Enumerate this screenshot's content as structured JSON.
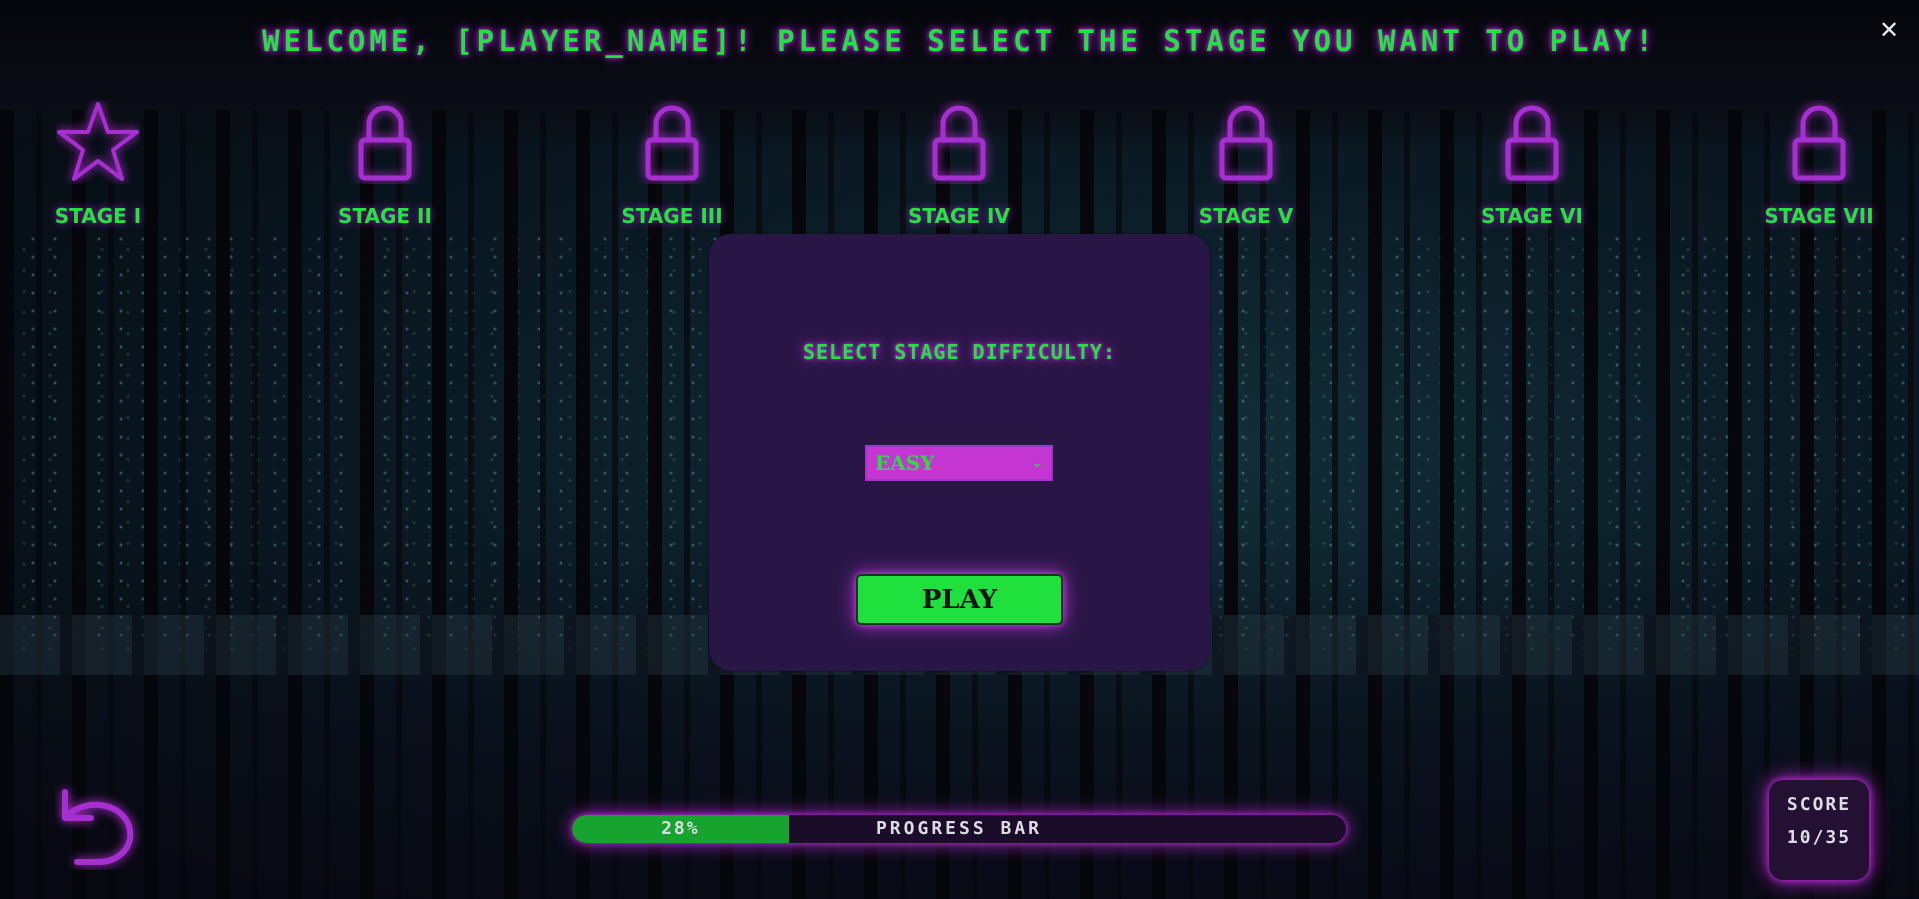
{
  "header": {
    "title": "WELCOME, [PLAYER_NAME]! PLEASE SELECT THE STAGE YOU WANT TO PLAY!",
    "close_icon": "close-icon"
  },
  "stages": [
    {
      "label": "STAGE I",
      "icon": "star-icon",
      "unlocked": true
    },
    {
      "label": "STAGE II",
      "icon": "lock-icon",
      "unlocked": false
    },
    {
      "label": "STAGE III",
      "icon": "lock-icon",
      "unlocked": false
    },
    {
      "label": "STAGE IV",
      "icon": "lock-icon",
      "unlocked": false
    },
    {
      "label": "STAGE V",
      "icon": "lock-icon",
      "unlocked": false
    },
    {
      "label": "STAGE VI",
      "icon": "lock-icon",
      "unlocked": false
    },
    {
      "label": "STAGE VII",
      "icon": "lock-icon",
      "unlocked": false
    }
  ],
  "modal": {
    "title": "SELECT STAGE DIFFICULTY:",
    "difficulty_selected": "EASY",
    "play_label": "PLAY"
  },
  "progress": {
    "percent_text": "28%",
    "percent": 28,
    "label": "PROGRESS BAR"
  },
  "score": {
    "title": "SCORE",
    "value": "10/35"
  },
  "nav": {
    "back_icon": "undo-arrow-icon"
  },
  "colors": {
    "neon_green": "#1fe43f",
    "neon_magenta": "#b622d6",
    "modal_bg": "#2a1646",
    "play_bg": "#1fe03d",
    "select_bg": "#c535d2"
  }
}
